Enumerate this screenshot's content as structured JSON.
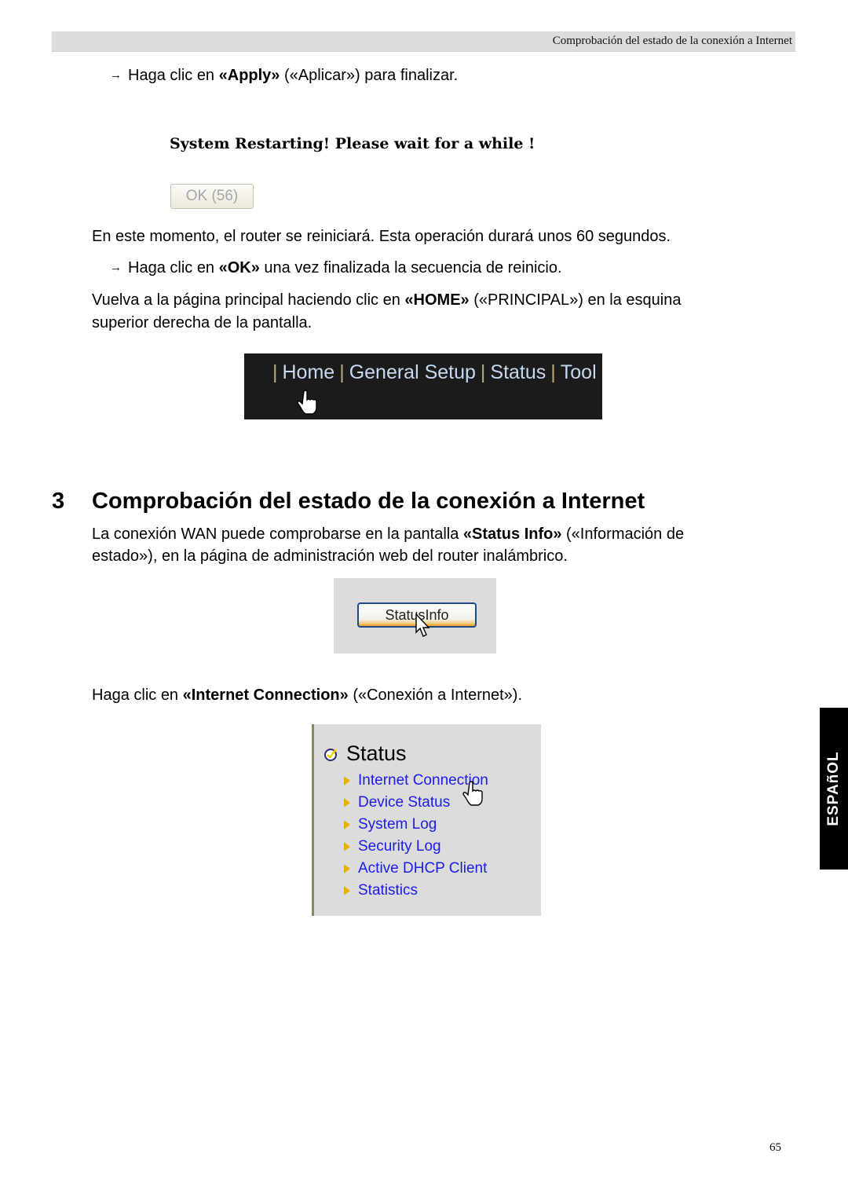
{
  "header": {
    "running_title": "Comprobación del estado de la conexión a Internet"
  },
  "steps": {
    "apply": {
      "arrow": "→",
      "pre": "Haga clic en ",
      "bold": "«Apply»",
      "post": " («Aplicar») para finalizar."
    },
    "restart_screen": {
      "title": "System Restarting! Please wait for a while !",
      "ok_button": "OK (56)"
    },
    "restart_note": "En este momento, el router se reiniciará. Esta operación durará unos 60 segundos.",
    "ok": {
      "arrow": "→",
      "pre": "Haga clic en ",
      "bold": "«OK»",
      "post": " una vez finalizada la secuencia de reinicio."
    },
    "home": {
      "pre": "Vuelva a la página principal haciendo clic en ",
      "bold": "«HOME»",
      "post": " («PRINCIPAL») en la esquina",
      "line2": "superior derecha de la pantalla."
    },
    "nav_screen": {
      "items": [
        "Home",
        "General Setup",
        "Status",
        "Tool"
      ],
      "separator": "|"
    }
  },
  "section": {
    "number": "3",
    "title": "Comprobación del estado de la conexión a Internet",
    "intro": {
      "pre": "La conexión WAN puede comprobarse en la pantalla ",
      "bold": "«Status Info»",
      "post": " («Información de",
      "line2": "estado»), en la página de administración web del router inalámbrico."
    },
    "status_info_button": "StatusInfo",
    "click_internet": {
      "pre": "Haga clic en ",
      "bold": "«Internet Connection»",
      "post": " («Conexión a Internet»)."
    },
    "status_menu": {
      "heading": "Status",
      "items": [
        "Internet Connection",
        "Device Status",
        "System Log",
        "Security Log",
        "Active DHCP Client",
        "Statistics"
      ]
    }
  },
  "side_tab": {
    "language": "ESPAñOL"
  },
  "footer": {
    "page_number": "65"
  }
}
